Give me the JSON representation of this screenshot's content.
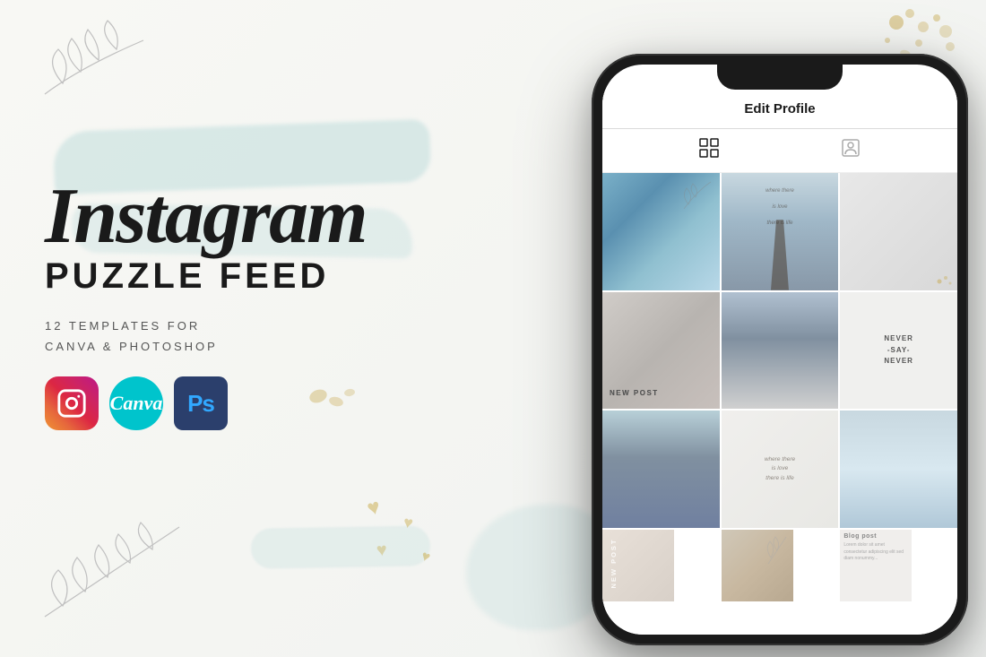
{
  "background": {
    "color": "#f5f5f0"
  },
  "left_section": {
    "title_line1": "Instagram",
    "title_line2": "PUZZLE FEED",
    "subtitle_line1": "12  TEMPLATES  FOR",
    "subtitle_line2": "CANVA & PHOTOSHOP",
    "icons": [
      {
        "name": "Instagram",
        "type": "instagram"
      },
      {
        "name": "Canva",
        "type": "canva",
        "label": "Canva"
      },
      {
        "name": "Photoshop",
        "type": "photoshop",
        "label": "Ps"
      }
    ]
  },
  "phone": {
    "header_title": "Edit Profile",
    "tabs": [
      {
        "name": "grid-tab",
        "active": true
      },
      {
        "name": "person-tab",
        "active": false
      }
    ],
    "grid_cells": [
      {
        "id": 1,
        "type": "ice-photo",
        "overlay": ""
      },
      {
        "id": 2,
        "type": "woman-beach",
        "overlay": "where there\nis love\nthere is life"
      },
      {
        "id": 3,
        "type": "text-cell",
        "overlay": "NEW POST"
      },
      {
        "id": 4,
        "type": "woman-snow",
        "overlay": ""
      },
      {
        "id": 5,
        "type": "text-never",
        "overlay": "NEVER\n-SAY-\nNEVER"
      },
      {
        "id": 6,
        "type": "women-back",
        "overlay": ""
      },
      {
        "id": 7,
        "type": "text-where",
        "overlay": "where there\nis love\nthere is life"
      },
      {
        "id": 8,
        "type": "winter-trees",
        "overlay": ""
      },
      {
        "id": 9,
        "type": "blog-post",
        "overlay": "NEW POST"
      }
    ]
  },
  "decorations": {
    "brush_strokes": [
      "mint-top",
      "mint-mid"
    ],
    "leaves": [
      "top-left",
      "bottom-left"
    ],
    "gold_hearts": true,
    "gold_splatter": true
  }
}
